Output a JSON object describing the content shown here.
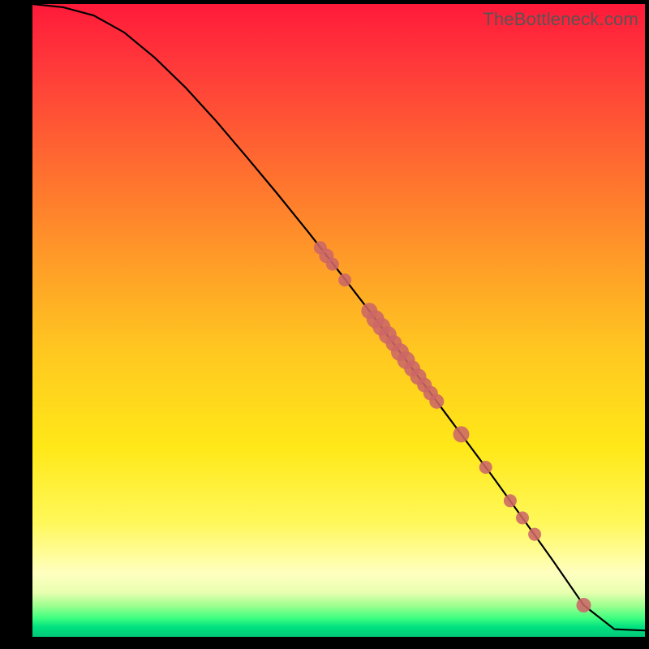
{
  "watermark": "TheBottleneck.com",
  "colors": {
    "curve": "#000000",
    "marker_fill": "#cc6666",
    "marker_stroke": "#d87878",
    "background_black": "#000000"
  },
  "chart_data": {
    "type": "line",
    "title": "",
    "xlabel": "",
    "ylabel": "",
    "xlim": [
      0,
      100
    ],
    "ylim": [
      0,
      100
    ],
    "curve": {
      "x": [
        0,
        5,
        10,
        15,
        20,
        25,
        30,
        35,
        40,
        45,
        50,
        55,
        60,
        65,
        70,
        75,
        80,
        85,
        90,
        95,
        100
      ],
      "y": [
        100,
        99.5,
        98.2,
        95.5,
        91.5,
        86.8,
        81.5,
        75.8,
        70.0,
        64.0,
        57.8,
        51.5,
        45.0,
        38.5,
        32.0,
        25.5,
        18.8,
        12.0,
        5.0,
        1.2,
        1.0
      ]
    },
    "markers": {
      "x": [
        47,
        48,
        49,
        51,
        55,
        56,
        57,
        58,
        59,
        60,
        61,
        62,
        63,
        64,
        65,
        66,
        70,
        74,
        78,
        80,
        82,
        90
      ],
      "y": [
        61.5,
        60.2,
        58.9,
        56.4,
        51.5,
        50.2,
        49.0,
        47.7,
        46.4,
        45.0,
        43.7,
        42.4,
        41.1,
        39.8,
        38.5,
        37.2,
        32.0,
        26.8,
        21.5,
        18.8,
        16.2,
        5.0
      ],
      "r": [
        8,
        9,
        8,
        8,
        10,
        11,
        11,
        11,
        10,
        11,
        11,
        10,
        10,
        9,
        9,
        9,
        10,
        8,
        8,
        8,
        8,
        9
      ]
    }
  }
}
